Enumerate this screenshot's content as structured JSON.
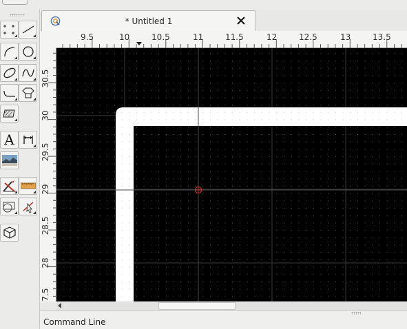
{
  "document": {
    "tab_title": "* Untitled 1",
    "tab_icon": "app-logo-icon",
    "close_icon": "close-icon"
  },
  "rulers": {
    "horizontal_labels": [
      "9.5",
      "10",
      "10.5",
      "11",
      "11.5",
      "12",
      "12.5",
      "13",
      "13.5"
    ],
    "vertical_labels": [
      "30.5",
      "30",
      "29.5",
      "29",
      "28.5",
      "28",
      "27.5"
    ]
  },
  "toolbox": {
    "tools": [
      {
        "name": "points-tool",
        "icon": "points-icon"
      },
      {
        "name": "line-tool",
        "icon": "line-icon"
      },
      {
        "name": "arc-tool",
        "icon": "arc-icon"
      },
      {
        "name": "circle-tool",
        "icon": "circle-icon"
      },
      {
        "name": "ellipse-tool",
        "icon": "ellipse-icon"
      },
      {
        "name": "spline-tool",
        "icon": "spline-icon"
      },
      {
        "name": "polyline-tool",
        "icon": "polyline-icon"
      },
      {
        "name": "polygon-tool",
        "icon": "polygon-icon"
      },
      {
        "name": "hatch-tool",
        "icon": "hatch-icon"
      },
      {
        "name": "text-tool",
        "icon": "text-icon",
        "label": "A"
      },
      {
        "name": "dimension-tool",
        "icon": "dimension-icon"
      },
      {
        "name": "image-tool",
        "icon": "image-icon"
      },
      {
        "name": "modify-tool",
        "icon": "modify-icon"
      },
      {
        "name": "measure-tool",
        "icon": "ruler-icon"
      },
      {
        "name": "block-tool",
        "icon": "block-icon"
      },
      {
        "name": "select-tool",
        "icon": "select-icon"
      },
      {
        "name": "3d-tool",
        "icon": "cube-icon"
      }
    ]
  },
  "colors": {
    "canvas_background": "#000000",
    "grid_dot": "#5a5a5a",
    "entity": "#ffffff",
    "crosshair": "#c0392b"
  },
  "command_line": {
    "label": "Command Line"
  }
}
